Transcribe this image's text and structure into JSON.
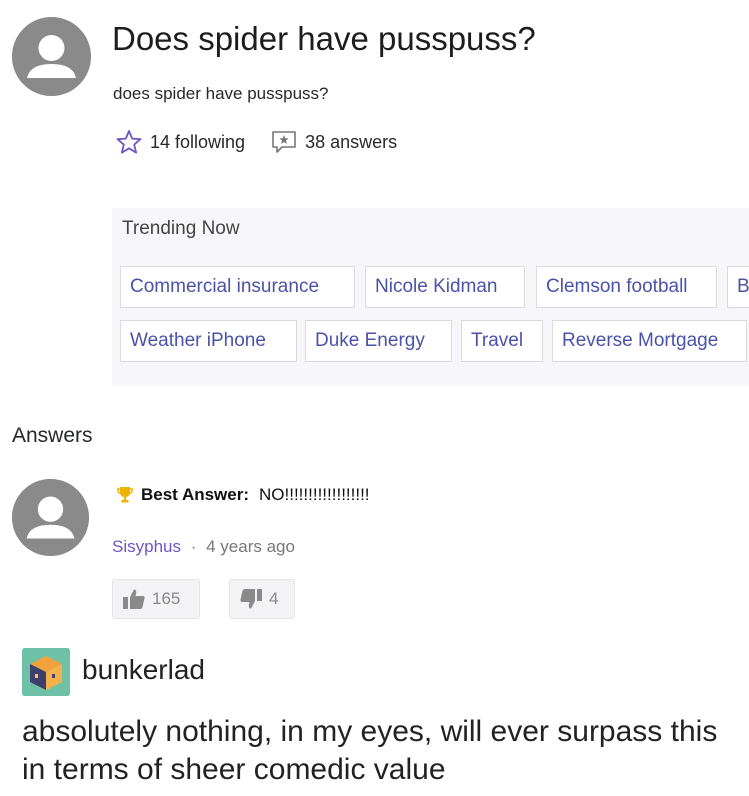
{
  "question": {
    "title": "Does spider have pusspuss?",
    "body": "does spider have pusspuss?",
    "following": "14 following",
    "answers_count": "38 answers"
  },
  "trending": {
    "title": "Trending Now",
    "row1": [
      "Commercial insurance",
      "Nicole Kidman",
      "Clemson football",
      "B"
    ],
    "row2": [
      "Weather iPhone",
      "Duke Energy",
      "Travel",
      "Reverse Mortgage"
    ]
  },
  "answers": {
    "heading": "Answers",
    "best_label": "Best Answer:",
    "best_text": "NO!!!!!!!!!!!!!!!!!!",
    "author": "Sisyphus",
    "separator": "·",
    "age": "4 years ago",
    "likes": "165",
    "dislikes": "4"
  },
  "post": {
    "username": "bunkerlad",
    "comment": "absolutely nothing, in my eyes, will ever surpass this in terms of sheer comedic value"
  },
  "icons": {
    "avatar": "user-avatar-icon",
    "star": "star-outline-icon",
    "answers": "answer-bubble-icon",
    "trophy": "trophy-icon",
    "thumbs_up": "thumbs-up-icon",
    "thumbs_down": "thumbs-down-icon",
    "tumblr_avatar": "cube-avatar-icon"
  },
  "colors": {
    "accent": "#6e55c4",
    "chip_text": "#4b52a8",
    "avatar_gray": "#8c8c8c",
    "trophy": "#f0b400"
  }
}
